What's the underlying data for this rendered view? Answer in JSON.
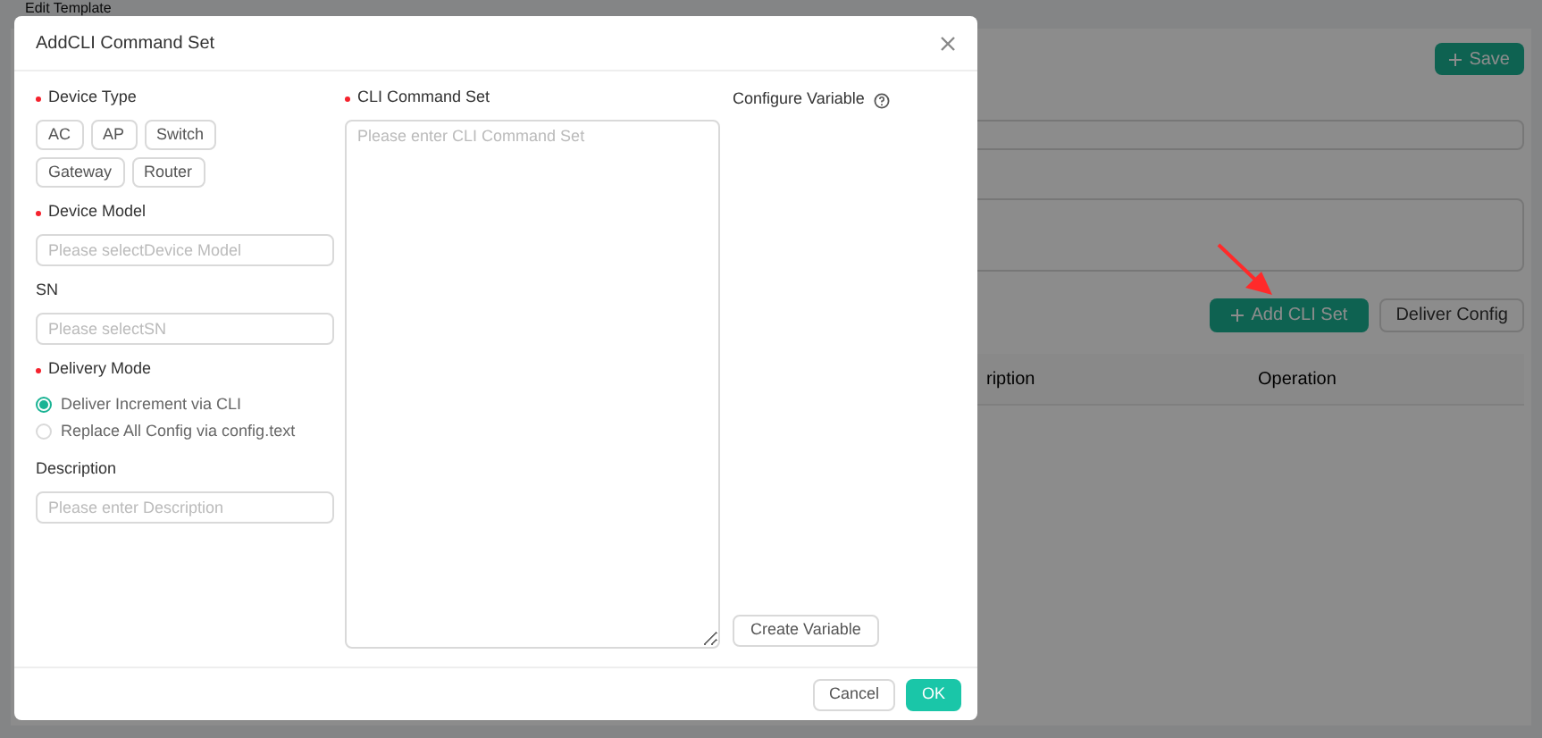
{
  "page": {
    "breadcrumb": "Edit Template",
    "save_button": "Save",
    "add_cli_button": "Add CLI Set",
    "deliver_button": "Deliver Config",
    "table_columns": [
      "ription",
      "Operation"
    ]
  },
  "dialog": {
    "title": "AddCLI Command Set",
    "device_type": {
      "label": "Device Type",
      "required": true,
      "options": [
        "AC",
        "AP",
        "Switch",
        "Gateway",
        "Router"
      ]
    },
    "fields": [
      {
        "label": "Device Model",
        "required": true,
        "placeholder": "Please selectDevice Model"
      },
      {
        "label": "SN",
        "required": false,
        "placeholder": "Please selectSN"
      }
    ],
    "delivery_mode": {
      "label": "Delivery Mode",
      "required": true,
      "options": [
        {
          "label": "Deliver Increment via CLI",
          "selected": true
        },
        {
          "label": "Replace All Config via config.text",
          "selected": false
        }
      ]
    },
    "description": {
      "label": "Description",
      "required": false,
      "placeholder": "Please enter Description"
    },
    "cli": {
      "label": "CLI Command Set",
      "required": true,
      "placeholder": "Please enter CLI Command Set"
    },
    "variables": {
      "label": "Configure Variable",
      "create_button": "Create Variable"
    },
    "buttons": {
      "cancel": "Cancel",
      "ok": "OK"
    }
  }
}
